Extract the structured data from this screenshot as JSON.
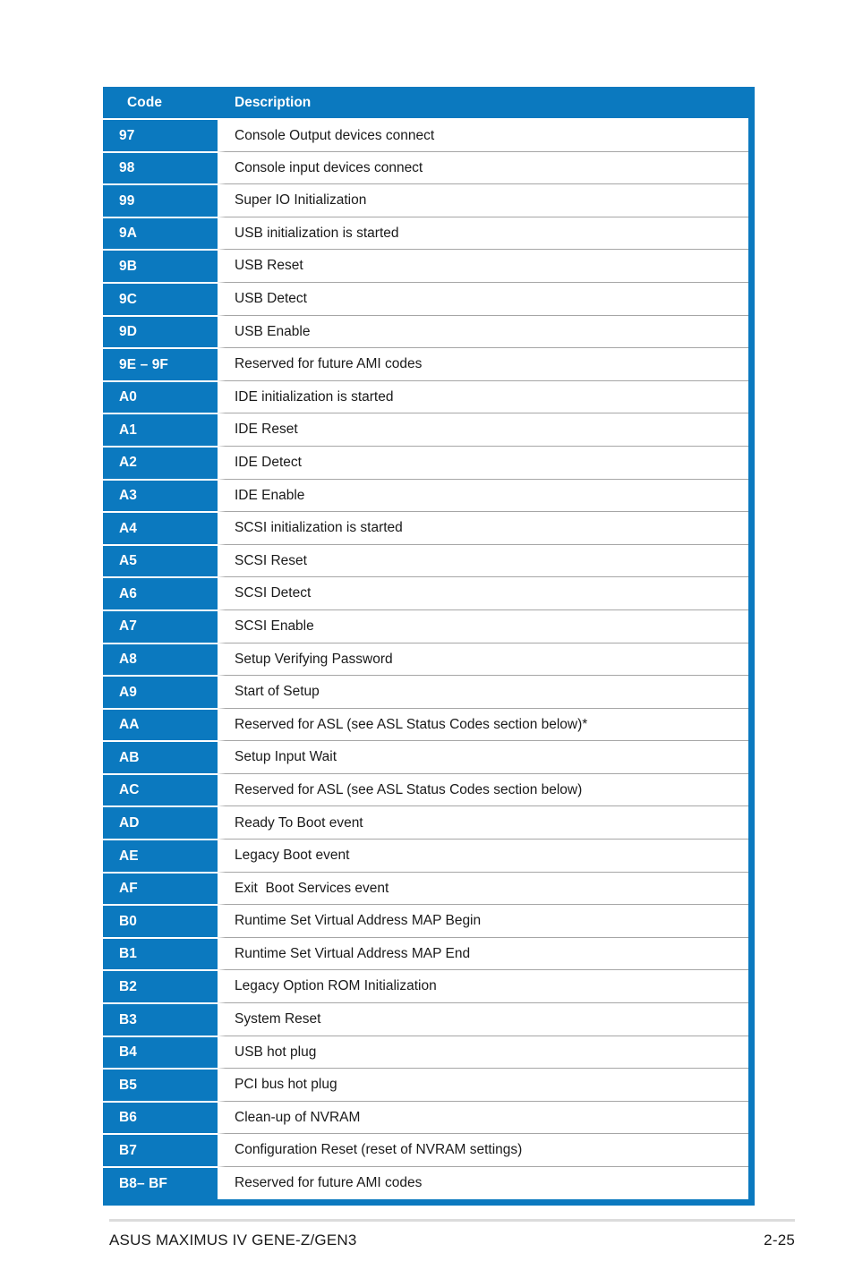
{
  "document": {
    "table": {
      "columns": [
        "Code",
        "Description"
      ],
      "rows": [
        {
          "code": "97",
          "description": "Console Output devices connect"
        },
        {
          "code": "98",
          "description": "Console input devices connect"
        },
        {
          "code": "99",
          "description": "Super IO Initialization"
        },
        {
          "code": "9A",
          "description": "USB initialization is started"
        },
        {
          "code": "9B",
          "description": "USB Reset"
        },
        {
          "code": "9C",
          "description": "USB Detect"
        },
        {
          "code": "9D",
          "description": "USB Enable"
        },
        {
          "code": "9E – 9F",
          "description": "Reserved for future AMI codes"
        },
        {
          "code": "A0",
          "description": "IDE initialization is started"
        },
        {
          "code": "A1",
          "description": "IDE Reset"
        },
        {
          "code": "A2",
          "description": "IDE Detect"
        },
        {
          "code": "A3",
          "description": "IDE Enable"
        },
        {
          "code": "A4",
          "description": "SCSI initialization is started"
        },
        {
          "code": "A5",
          "description": "SCSI Reset"
        },
        {
          "code": "A6",
          "description": "SCSI Detect"
        },
        {
          "code": "A7",
          "description": "SCSI Enable"
        },
        {
          "code": "A8",
          "description": "Setup Verifying Password"
        },
        {
          "code": "A9",
          "description": "Start of Setup"
        },
        {
          "code": "AA",
          "description": "Reserved for ASL (see ASL Status Codes section below)*"
        },
        {
          "code": "AB",
          "description": "Setup Input Wait"
        },
        {
          "code": "AC",
          "description": "Reserved for ASL (see ASL Status Codes section below)"
        },
        {
          "code": "AD",
          "description": "Ready To Boot event"
        },
        {
          "code": "AE",
          "description": "Legacy Boot event"
        },
        {
          "code": "AF",
          "description": "Exit  Boot Services event"
        },
        {
          "code": "B0",
          "description": "Runtime Set Virtual Address MAP Begin"
        },
        {
          "code": "B1",
          "description": "Runtime Set Virtual Address MAP End"
        },
        {
          "code": "B2",
          "description": "Legacy Option ROM Initialization"
        },
        {
          "code": "B3",
          "description": "System Reset"
        },
        {
          "code": "B4",
          "description": "USB hot plug"
        },
        {
          "code": "B5",
          "description": "PCI bus hot plug"
        },
        {
          "code": "B6",
          "description": "Clean-up of NVRAM"
        },
        {
          "code": "B7",
          "description": "Configuration Reset (reset of NVRAM settings)"
        },
        {
          "code": "B8– BF",
          "description": "Reserved for future AMI codes"
        }
      ]
    },
    "footer": {
      "product": "ASUS MAXIMUS IV GENE-Z/GEN3",
      "page_number": "2-25"
    },
    "colors": {
      "accent_blue": "#0b79bf",
      "row_separator": "#a6a6a6",
      "footer_rule": "#dcdcdc",
      "text": "#1a1a1a",
      "background": "#ffffff"
    }
  }
}
